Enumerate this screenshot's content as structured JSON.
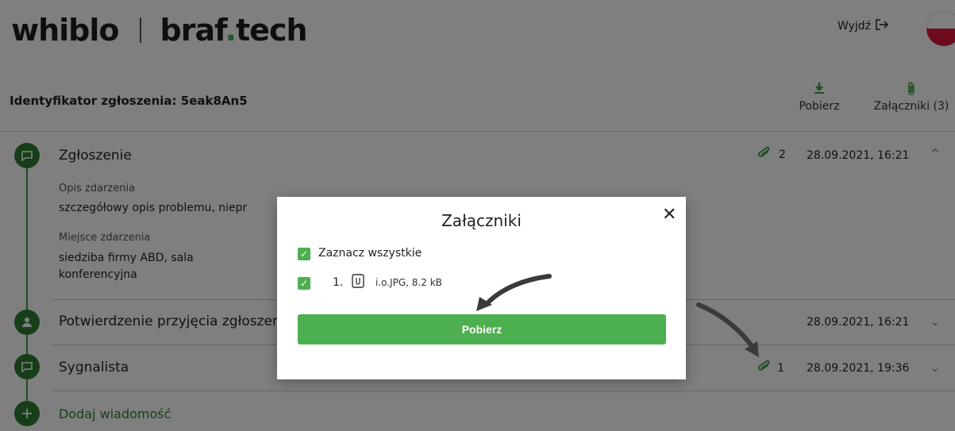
{
  "header": {
    "logo_left": "whiblo",
    "logo_right_a": "braf",
    "logo_right_dot": ".",
    "logo_right_b": "tech",
    "logout_label": "Wyjdź",
    "logout_icon": "logout-icon",
    "language_flag": "pl-flag"
  },
  "toolbar": {
    "identifier": "Identyfikator zgłoszenia: 5eak8An5",
    "download_label": "Pobierz",
    "download_icon": "download-icon",
    "attachments_label": "Załączniki (3)",
    "attachments_icon": "paperclip-icon"
  },
  "timeline": {
    "items": [
      {
        "title": "Zgłoszenie",
        "icon": "message-icon",
        "attachments_count": "2",
        "date": "28.09.2021, 16:21",
        "expanded": true,
        "fields": [
          {
            "label": "Opis zdarzenia",
            "value": "szczegółowy opis  problemu, niepr"
          },
          {
            "label": "Miejsce zdarzenia",
            "value_line1": "siedziba firmy ABD, sala",
            "value_line2": "konferencyjna"
          }
        ]
      },
      {
        "title": "Potwierdzenie przyjęcia zgłoszer",
        "icon": "person-icon",
        "date": "28.09.2021, 16:21",
        "expanded": false
      },
      {
        "title": "Sygnalista",
        "icon": "message-icon",
        "attachments_count": "1",
        "date": "28.09.2021, 19:36",
        "expanded": false
      }
    ],
    "add_message": "Dodaj wiadomość"
  },
  "modal": {
    "title": "Załączniki",
    "select_all_label": "Zaznacz wszystkie",
    "select_all_checked": true,
    "files": [
      {
        "index": "1.",
        "name": "i.o.JPG, 8.2 kB",
        "checked": true,
        "icon": "file-attachment-icon"
      }
    ],
    "download_button": "Pobierz"
  },
  "colors": {
    "accent": "#4caf50",
    "accent_dark": "#2e7d32",
    "overlay": "rgba(0,0,0,0.5)"
  }
}
